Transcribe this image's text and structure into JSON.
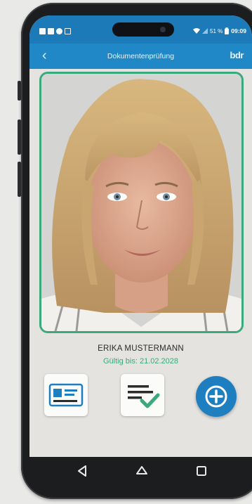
{
  "status_bar": {
    "left_icons": [
      "image-icon",
      "video-icon",
      "circle-icon",
      "sim-icon"
    ],
    "battery_text": "51 %",
    "time": "09:09"
  },
  "app_bar": {
    "back_icon": "chevron-left-icon",
    "title": "Dokumentenprüfung",
    "brand": "bdr"
  },
  "person": {
    "name": "ERIKA MUSTERMANN",
    "valid_until": "Gültig bis: 21.02.2028"
  },
  "actions": [
    {
      "icon": "id-card-icon"
    },
    {
      "icon": "document-check-icon"
    },
    {
      "icon": "add-circle-icon"
    }
  ],
  "nav": [
    "back-triangle-icon",
    "home-circle-icon",
    "recents-square-icon"
  ],
  "colors": {
    "primary_blue": "#2088c6",
    "status_blue": "#1c7ab9",
    "accent_green": "#3aaa7c",
    "screen_bg": "#e4e3df"
  }
}
